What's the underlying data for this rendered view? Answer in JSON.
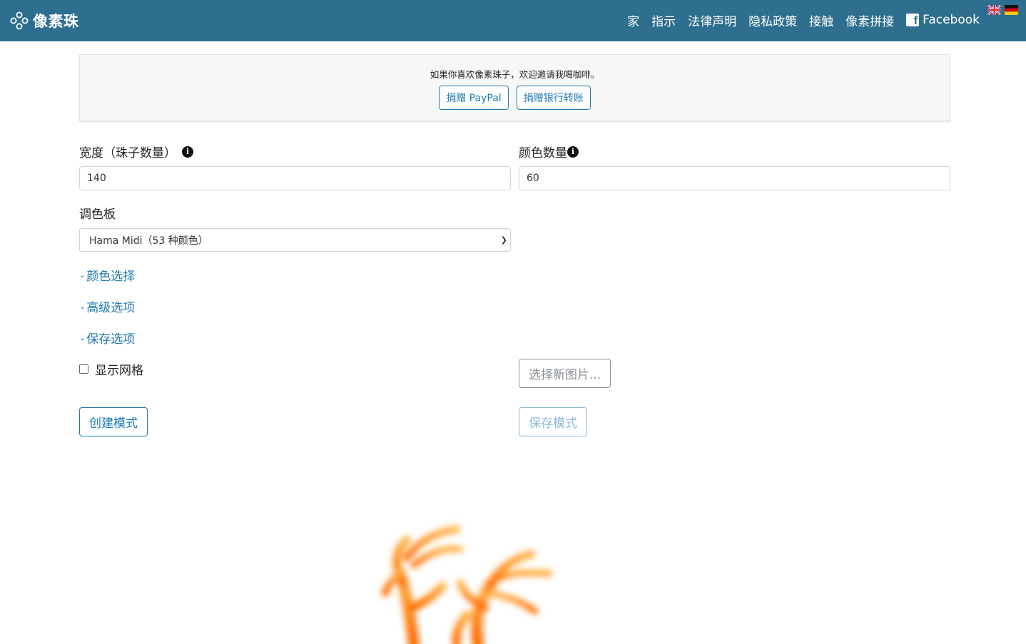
{
  "navbar": {
    "brand": "像素珠",
    "links": [
      "家",
      "指示",
      "法律声明",
      "隐私政策",
      "接触",
      "像素拼接"
    ],
    "facebook": "Facebook",
    "flags": [
      "uk-flag",
      "germany-flag"
    ]
  },
  "donate": {
    "text": "如果你喜欢像素珠子，欢迎邀请我喝咖啡。",
    "paypal_label": "捐赠 PayPal",
    "bank_label": "捐赠银行转账"
  },
  "form": {
    "width_label": "宽度（珠子数量）",
    "width_value": "140",
    "colors_label": "颜色数量",
    "colors_value": "60",
    "palette_label": "调色板",
    "palette_value": "Hama Midi（53 种颜色）",
    "color_selection": "颜色选择",
    "advanced_options": "高级选项",
    "save_options": "保存选项",
    "show_grid": "显示网格",
    "select_image": "选择新图片...",
    "create_pattern": "创建模式",
    "save_pattern": "保存模式"
  },
  "colors": {
    "navbar": "#2e6e8e",
    "accent": "#1f7ab2"
  }
}
